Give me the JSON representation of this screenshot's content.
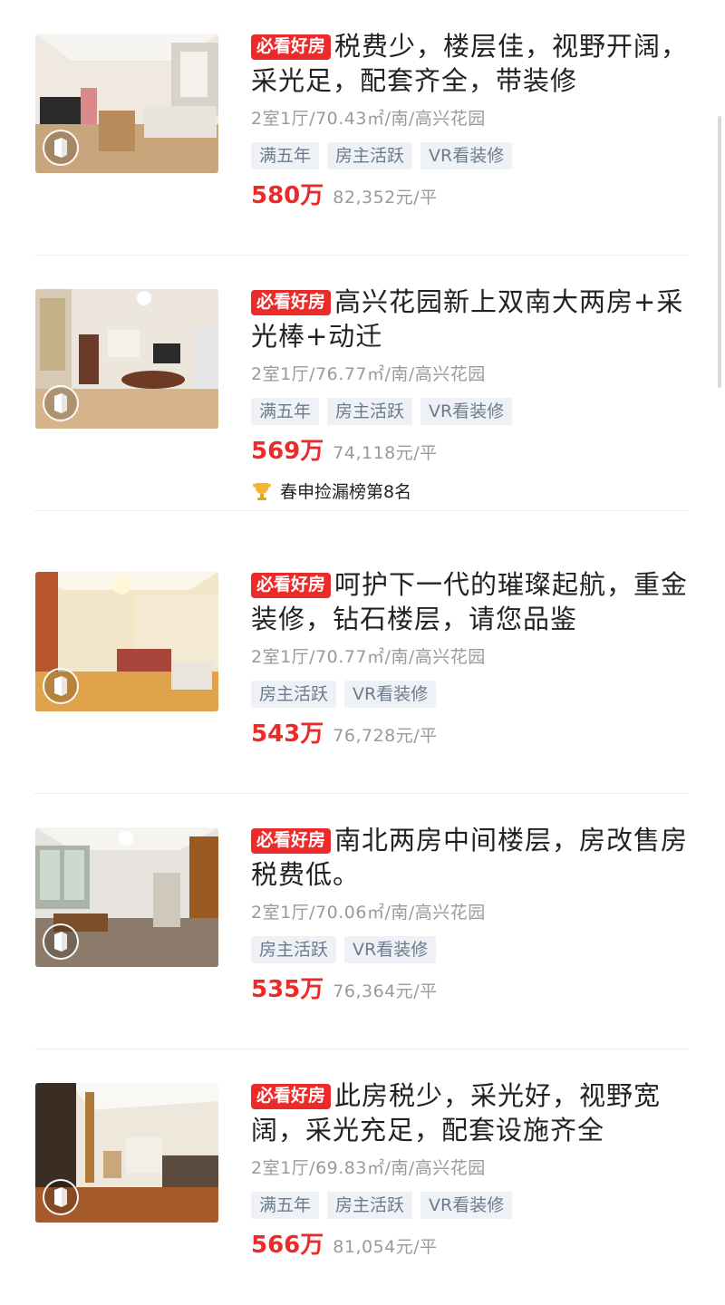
{
  "listings": [
    {
      "badge": "必看好房",
      "title": "税费少，楼层佳，视野开阔，采光足，配套齐全，带装修",
      "meta": "2室1厅/70.43㎡/南/高兴花园",
      "tags": [
        "满五年",
        "房主活跃",
        "VR看装修"
      ],
      "price": "580万",
      "unit_price": "82,352元/平",
      "rank": ""
    },
    {
      "badge": "必看好房",
      "title": "高兴花园新上双南大两房+采光棒+动迁",
      "meta": "2室1厅/76.77㎡/南/高兴花园",
      "tags": [
        "满五年",
        "房主活跃",
        "VR看装修"
      ],
      "price": "569万",
      "unit_price": "74,118元/平",
      "rank": "春申捡漏榜第8名"
    },
    {
      "badge": "必看好房",
      "title": "呵护下一代的璀璨起航，重金装修，钻石楼层，请您品鉴",
      "meta": "2室1厅/70.77㎡/南/高兴花园",
      "tags": [
        "房主活跃",
        "VR看装修"
      ],
      "price": "543万",
      "unit_price": "76,728元/平",
      "rank": ""
    },
    {
      "badge": "必看好房",
      "title": "南北两房中间楼层，房改售房税费低。",
      "meta": "2室1厅/70.06㎡/南/高兴花园",
      "tags": [
        "房主活跃",
        "VR看装修"
      ],
      "price": "535万",
      "unit_price": "76,364元/平",
      "rank": ""
    },
    {
      "badge": "必看好房",
      "title": "此房税少，采光好，视野宽阔，采光充足，配套设施齐全",
      "meta": "2室1厅/69.83㎡/南/高兴花园",
      "tags": [
        "满五年",
        "房主活跃",
        "VR看装修"
      ],
      "price": "566万",
      "unit_price": "81,054元/平",
      "rank": ""
    }
  ],
  "icons": {
    "vr": "vr-panorama-icon",
    "rank": "trophy-icon"
  },
  "colors": {
    "accent_red": "#ec2a2a",
    "tag_bg": "#eef2f7",
    "tag_text": "#6c7b8c",
    "muted_text": "#9a9a9a"
  }
}
